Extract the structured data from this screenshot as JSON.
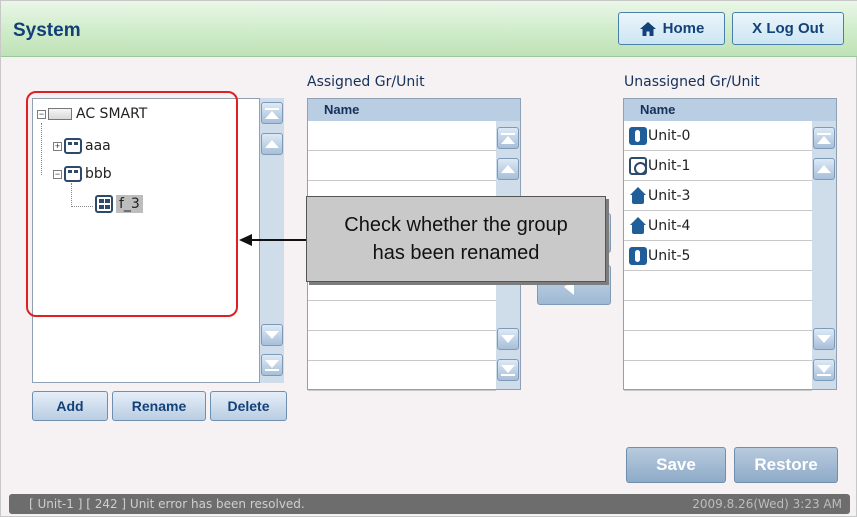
{
  "header": {
    "title": "System",
    "home_label": "Home",
    "logout_label": "X Log Out"
  },
  "tree": {
    "nodes": [
      {
        "label": "AC SMART"
      },
      {
        "label": "aaa"
      },
      {
        "label": "bbb"
      },
      {
        "label": "f_3"
      }
    ],
    "buttons": {
      "add": "Add",
      "rename": "Rename",
      "delete": "Delete"
    }
  },
  "assigned": {
    "title": "Assigned Gr/Unit",
    "column_header": "Name",
    "items": []
  },
  "unassigned": {
    "title": "Unassigned Gr/Unit",
    "column_header": "Name",
    "items": [
      {
        "label": "Unit-0",
        "icon": "indoor-unit-icon"
      },
      {
        "label": "Unit-1",
        "icon": "ventilation-unit-icon"
      },
      {
        "label": "Unit-3",
        "icon": "outdoor-unit-icon"
      },
      {
        "label": "Unit-4",
        "icon": "outdoor-unit-icon"
      },
      {
        "label": "Unit-5",
        "icon": "indoor-unit-icon"
      }
    ]
  },
  "actions": {
    "save": "Save",
    "restore": "Restore"
  },
  "callout": {
    "line1": "Check whether the group",
    "line2": "has been renamed"
  },
  "status": {
    "message": "[ Unit-1 ] [ 242 ] Unit error has been resolved.",
    "datetime": "2009.8.26(Wed)  3:23 AM"
  }
}
